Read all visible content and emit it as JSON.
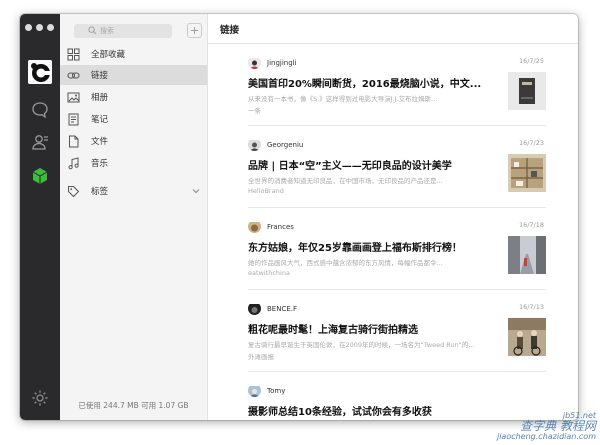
{
  "search": {
    "placeholder": "搜索"
  },
  "sidebar": {
    "items": [
      {
        "label": "全部收藏",
        "icon": "grid-icon"
      },
      {
        "label": "链接",
        "icon": "link-icon"
      },
      {
        "label": "相册",
        "icon": "photo-icon"
      },
      {
        "label": "笔记",
        "icon": "note-icon"
      },
      {
        "label": "文件",
        "icon": "file-icon"
      },
      {
        "label": "音乐",
        "icon": "music-icon"
      },
      {
        "label": "标签",
        "icon": "tag-icon"
      }
    ],
    "active_index": 1,
    "storage": "已使用 244.7 MB 可用 1.07 GB"
  },
  "main": {
    "title": "链接",
    "items": [
      {
        "author": "Jingjingli",
        "date": "16/7/25",
        "title": "美国首印20%瞬间断货，2016最烧脑小说，中文...",
        "desc": "从来没有一本书，像《S.》这样得到过电影大导演J.J.艾布拉姆斯...",
        "source": "一条"
      },
      {
        "author": "Georgeniu",
        "date": "16/7/23",
        "title": "品牌 | 日本“空”主义——无印良品的设计美学",
        "desc": "全世界的消费者知道无印良品，在中国市场，无印良品的产品还是...",
        "source": "HelloBrand"
      },
      {
        "author": "Frances",
        "date": "16/7/18",
        "title": "东方姑娘，年仅25岁靠画画登上福布斯排行榜！",
        "desc": "她的作品画风大气，西式感中蕴含浓郁的东方风情，每幅作品都令...",
        "source": "eatwithchina"
      },
      {
        "author": "BENCE.F",
        "date": "16/7/13",
        "title": "粗花呢最时髦！上海复古骑行街拍精选",
        "desc": "复古骑行最早诞生于英国伦敦，在2009年的时候，一场名为“Tweed Run”的...",
        "source": "外滩画报"
      },
      {
        "author": "Tomy",
        "date": "",
        "title": "摄影师总结10条经验，试试你会有多收获",
        "desc": "",
        "source": ""
      }
    ]
  },
  "watermark": {
    "line1": "jb51.net",
    "line2": "查字典 教程网",
    "line3": "jiaocheng.chazidian.com"
  },
  "colors": {
    "iconbar": "#2a2a2c",
    "active_green": "#3dbb3d",
    "sidebar_bg": "#f4f4f4",
    "active_item": "#dcdcdc"
  }
}
